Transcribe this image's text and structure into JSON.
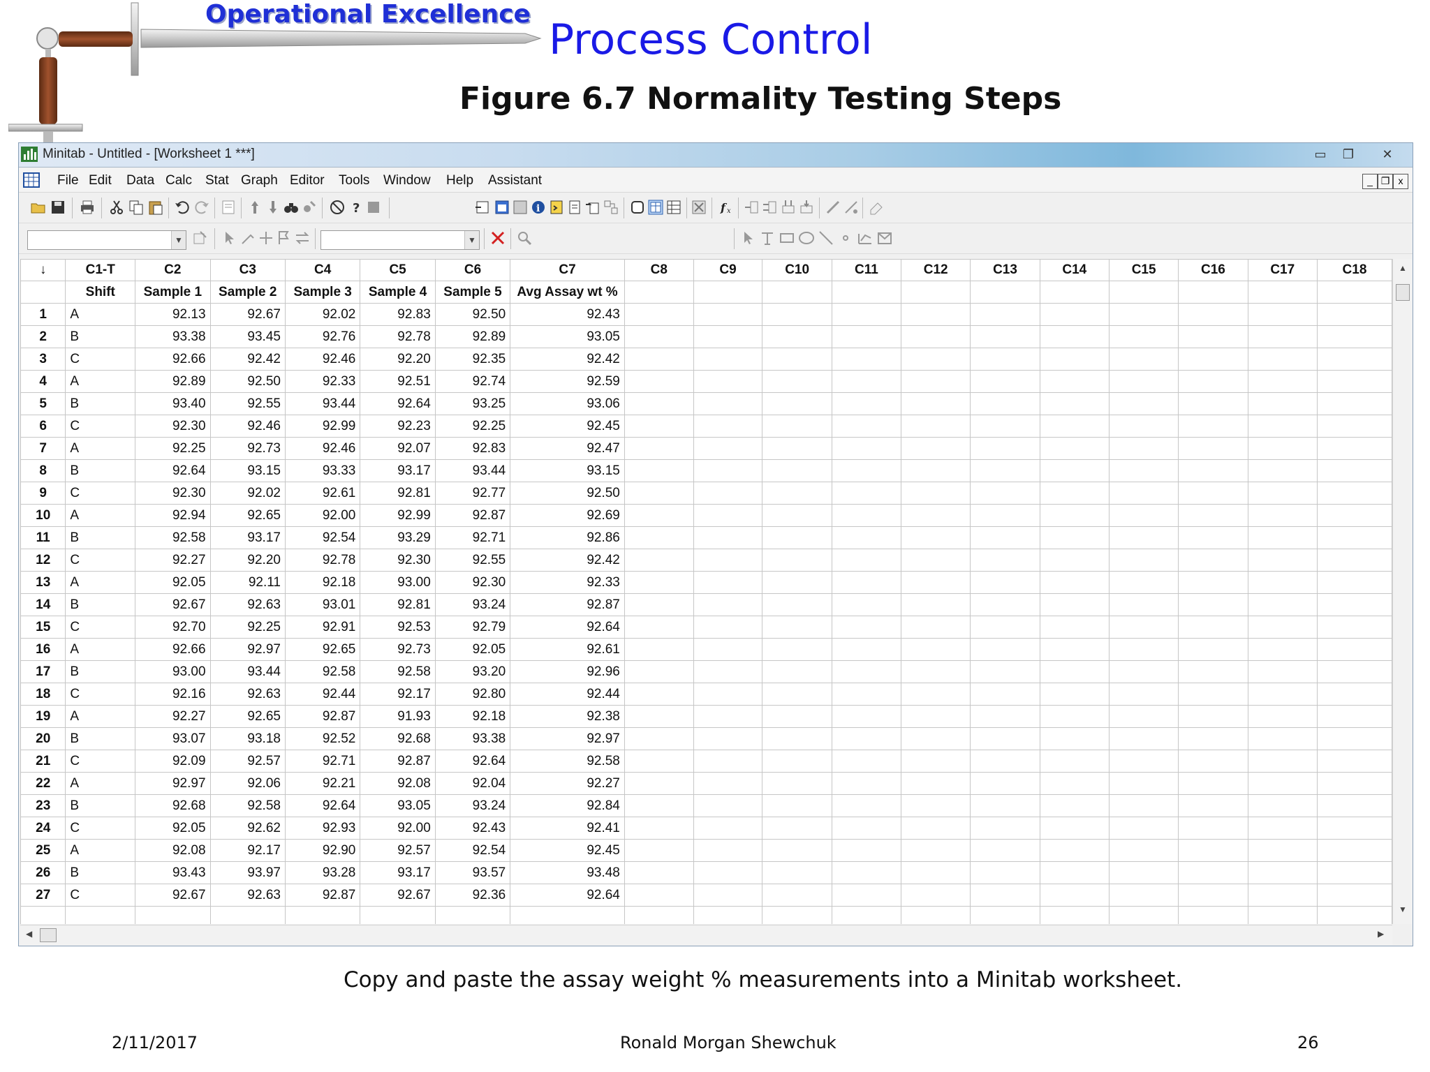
{
  "slide": {
    "brand": "Operational Excellence",
    "title": "Process Control",
    "figure_title": "Figure 6.7  Normality Testing Steps",
    "caption": "Copy and paste the assay weight % measurements into a Minitab worksheet.",
    "footer": {
      "date": "2/11/2017",
      "author": "Ronald Morgan Shewchuk",
      "page": "26"
    },
    "logo_icon": "sword-icon"
  },
  "window": {
    "title": "Minitab - Untitled - [Worksheet 1 ***]",
    "controls": {
      "minimize": "minimize-icon",
      "maximize": "restore-icon",
      "close": "close-icon"
    },
    "mdi_controls": [
      "_",
      "❐",
      "x"
    ]
  },
  "menu": [
    "File",
    "Edit",
    "Data",
    "Calc",
    "Stat",
    "Graph",
    "Editor",
    "Tools",
    "Window",
    "Help",
    "Assistant"
  ],
  "toolbar1": [
    "open-icon",
    "save-icon",
    "print-icon",
    "cut-icon",
    "copy-icon",
    "paste-icon",
    "undo-icon",
    "redo-icon",
    "edit-last-dialog-icon",
    "move-up-icon",
    "move-down-icon",
    "find-icon",
    "replace-icon",
    "cancel-icon",
    "help-icon",
    "stat-guide-icon",
    "session-window-icon",
    "worksheet-icon",
    "info-icon",
    "history-icon",
    "report-pad-icon",
    "output-icon",
    "project-manager-icon",
    "manage-graphs-icon",
    "data-window-icon",
    "show-worksheets-icon",
    "close-graphs-icon",
    "formula-icon",
    "insert-cells-icon",
    "insert-rows-icon",
    "insert-columns-icon",
    "move-columns-icon",
    "brush-icon",
    "set-id-variables-icon",
    "eraser-icon"
  ],
  "toolbar2": [
    "properties-icon",
    "select-icon",
    "brush-tool-icon",
    "crosshairs-icon",
    "flag-icon",
    "swap-icon",
    "delete-red-x-icon",
    "zoom-icon",
    "pointer-icon",
    "text-tool-icon",
    "rectangle-tool-icon",
    "ellipse-tool-icon",
    "line-tool-icon",
    "marker-tool-icon",
    "polyline-tool-icon",
    "polygon-tool-icon"
  ],
  "worksheet": {
    "corner": "↓",
    "columns": [
      "C1-T",
      "C2",
      "C3",
      "C4",
      "C5",
      "C6",
      "C7",
      "C8",
      "C9",
      "C10",
      "C11",
      "C12",
      "C13",
      "C14",
      "C15",
      "C16",
      "C17",
      "C18"
    ],
    "names": [
      "Shift",
      "Sample 1",
      "Sample 2",
      "Sample 3",
      "Sample 4",
      "Sample 5",
      "Avg Assay wt %",
      "",
      "",
      "",
      "",
      "",
      "",
      "",
      "",
      "",
      "",
      ""
    ],
    "rows": [
      [
        "A",
        "92.13",
        "92.67",
        "92.02",
        "92.83",
        "92.50",
        "92.43"
      ],
      [
        "B",
        "93.38",
        "93.45",
        "92.76",
        "92.78",
        "92.89",
        "93.05"
      ],
      [
        "C",
        "92.66",
        "92.42",
        "92.46",
        "92.20",
        "92.35",
        "92.42"
      ],
      [
        "A",
        "92.89",
        "92.50",
        "92.33",
        "92.51",
        "92.74",
        "92.59"
      ],
      [
        "B",
        "93.40",
        "92.55",
        "93.44",
        "92.64",
        "93.25",
        "93.06"
      ],
      [
        "C",
        "92.30",
        "92.46",
        "92.99",
        "92.23",
        "92.25",
        "92.45"
      ],
      [
        "A",
        "92.25",
        "92.73",
        "92.46",
        "92.07",
        "92.83",
        "92.47"
      ],
      [
        "B",
        "92.64",
        "93.15",
        "93.33",
        "93.17",
        "93.44",
        "93.15"
      ],
      [
        "C",
        "92.30",
        "92.02",
        "92.61",
        "92.81",
        "92.77",
        "92.50"
      ],
      [
        "A",
        "92.94",
        "92.65",
        "92.00",
        "92.99",
        "92.87",
        "92.69"
      ],
      [
        "B",
        "92.58",
        "93.17",
        "92.54",
        "93.29",
        "92.71",
        "92.86"
      ],
      [
        "C",
        "92.27",
        "92.20",
        "92.78",
        "92.30",
        "92.55",
        "92.42"
      ],
      [
        "A",
        "92.05",
        "92.11",
        "92.18",
        "93.00",
        "92.30",
        "92.33"
      ],
      [
        "B",
        "92.67",
        "92.63",
        "93.01",
        "92.81",
        "93.24",
        "92.87"
      ],
      [
        "C",
        "92.70",
        "92.25",
        "92.91",
        "92.53",
        "92.79",
        "92.64"
      ],
      [
        "A",
        "92.66",
        "92.97",
        "92.65",
        "92.73",
        "92.05",
        "92.61"
      ],
      [
        "B",
        "93.00",
        "93.44",
        "92.58",
        "92.58",
        "93.20",
        "92.96"
      ],
      [
        "C",
        "92.16",
        "92.63",
        "92.44",
        "92.17",
        "92.80",
        "92.44"
      ],
      [
        "A",
        "92.27",
        "92.65",
        "92.87",
        "91.93",
        "92.18",
        "92.38"
      ],
      [
        "B",
        "93.07",
        "93.18",
        "92.52",
        "92.68",
        "93.38",
        "92.97"
      ],
      [
        "C",
        "92.09",
        "92.57",
        "92.71",
        "92.87",
        "92.64",
        "92.58"
      ],
      [
        "A",
        "92.97",
        "92.06",
        "92.21",
        "92.08",
        "92.04",
        "92.27"
      ],
      [
        "B",
        "92.68",
        "92.58",
        "92.64",
        "93.05",
        "93.24",
        "92.84"
      ],
      [
        "C",
        "92.05",
        "92.62",
        "92.93",
        "92.00",
        "92.43",
        "92.41"
      ],
      [
        "A",
        "92.08",
        "92.17",
        "92.90",
        "92.57",
        "92.54",
        "92.45"
      ],
      [
        "B",
        "93.43",
        "93.97",
        "93.28",
        "93.17",
        "93.57",
        "93.48"
      ],
      [
        "C",
        "92.67",
        "92.63",
        "92.87",
        "92.67",
        "92.36",
        "92.64"
      ]
    ]
  }
}
